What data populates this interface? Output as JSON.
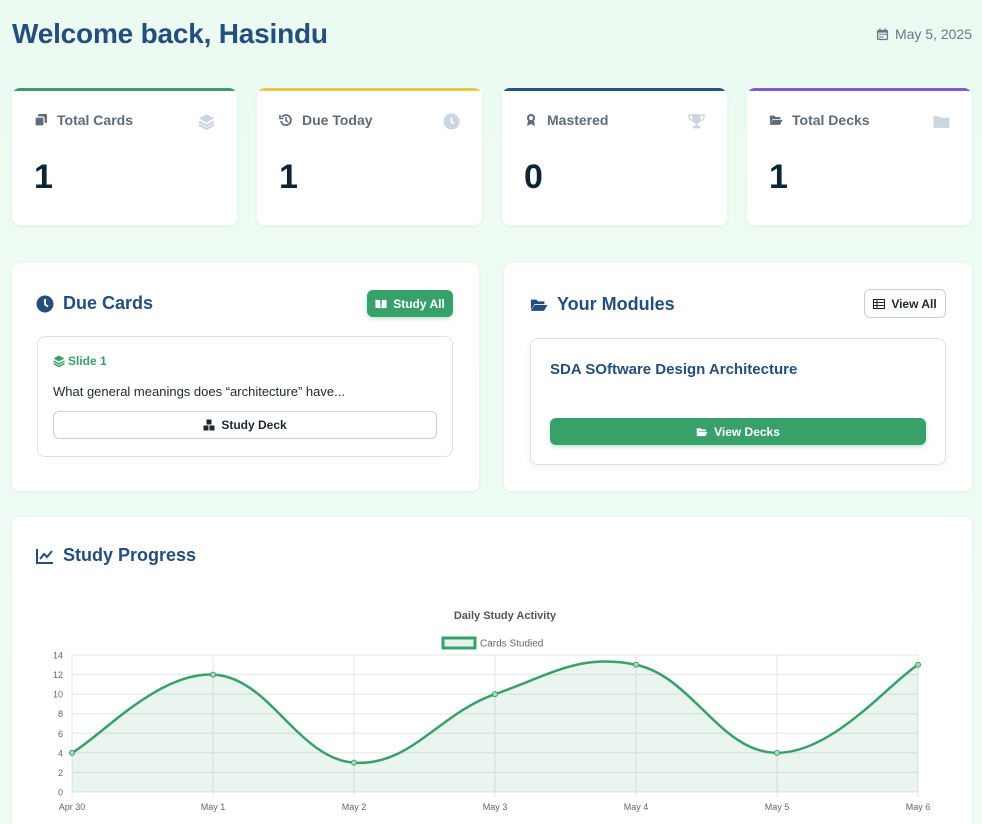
{
  "header": {
    "title": "Welcome back, Hasindu",
    "date": "May 5, 2025"
  },
  "stats": [
    {
      "label": "Total Cards",
      "value": "1",
      "accent": "#38a169",
      "icon": "copy-icon",
      "faint_icon": "layers-icon"
    },
    {
      "label": "Due Today",
      "value": "1",
      "accent": "#ecc94b",
      "icon": "history-icon",
      "faint_icon": "clock-icon"
    },
    {
      "label": "Mastered",
      "value": "0",
      "accent": "#2c5282",
      "icon": "award-icon",
      "faint_icon": "trophy-icon"
    },
    {
      "label": "Total Decks",
      "value": "1",
      "accent": "#805ad5",
      "icon": "folder-open-icon",
      "faint_icon": "folder-icon"
    }
  ],
  "due_cards": {
    "title": "Due Cards",
    "study_all_label": "Study All",
    "items": [
      {
        "deck": "Slide 1",
        "question": "What general meanings does “architecture” have...",
        "button": "Study Deck"
      }
    ]
  },
  "modules": {
    "title": "Your Modules",
    "view_all_label": "View All",
    "items": [
      {
        "name": "SDA SOftware Design Architecture",
        "button": "View Decks"
      }
    ]
  },
  "progress": {
    "title": "Study Progress"
  },
  "colors": {
    "primary_green": "#38a169",
    "heading_blue": "#244e7d"
  },
  "chart_data": {
    "type": "line",
    "title": "Daily Study Activity",
    "categories": [
      "Apr 30",
      "May 1",
      "May 2",
      "May 3",
      "May 4",
      "May 5",
      "May 6"
    ],
    "series": [
      {
        "name": "Cards Studied",
        "values": [
          4,
          12,
          3,
          10,
          13,
          4,
          13
        ],
        "color": "#38a169"
      }
    ],
    "ylim": [
      0,
      14
    ],
    "yticks": [
      0,
      2,
      4,
      6,
      8,
      10,
      12,
      14
    ],
    "legend": "top",
    "grid": true,
    "fill": true,
    "smooth": true
  }
}
